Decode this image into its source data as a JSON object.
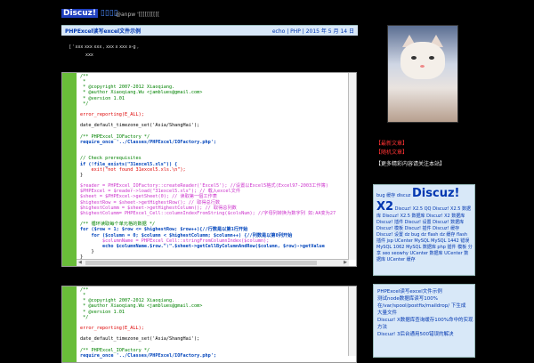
{
  "header": {
    "title": "Discuz!",
    "subtitle": "@anpw '[[[[[[[[[["
  },
  "post": {
    "title": "PHPExcel读写excel文件示例",
    "meta": "echo | PHP | 2015 年 5 月 14 日",
    "intro": "[ ' xxx        xxx              xxx         ,        xxx         x xxx x-g     ,",
    "intro2": "xxx"
  },
  "code_block_1": {
    "lines": [
      "/**",
      " *",
      " * @copyright 2007-2012 Xiaoqiang.",
      " * @author Xiaoqiang.Wu <jamblues@gmail.com>",
      " * @version 1.01",
      " */",
      "",
      "error_reporting(E_ALL);",
      "",
      "date_default_timezone_set('Asia/ShangHai');",
      "",
      "/** PHPExcel_IOFactory */",
      "require_once '../Classes/PHPExcel/IOFactory.php';",
      "",
      "",
      "// Check prerequisites",
      "if (!file_exists(\"31excel5.xls\")) {",
      "    exit(\"not found 31excel5.xls.\\n\");",
      "}",
      "",
      "$reader = PHPExcel_IOFactory::createReader('Excel5'); //设置以Excel5格式(Excel97-2003工作簿)",
      "$PHPExcel = $reader->load(\"31excel5.xls\"); // 载入excel文件",
      "$sheet = $PHPExcel->getSheet(0); // 读取第一個工作表",
      "$highestRow = $sheet->getHighestRow(); // 取得总行数",
      "$highestColumm = $sheet->getHighestColumn(); // 取得总列数",
      "$highestColumm= PHPExcel_Cell::columnIndexFromString($colsNum); //字母列转换为数字列 如:AA变为27",
      "",
      "/** 循环读取每个单元格的数据 */",
      "for ($row = 1; $row <= $highestRow; $row++){//行数是以第1行开始",
      "    for ($column = 0; $column < $highestColumm; $column++) {//列数是以第0列开始",
      "        $columnName = PHPExcel_Cell::stringFromColumnIndex($column);",
      "        echo $columnName.$row.\":\".$sheet->getCellByColumnAndRow($column, $row)->getValue",
      "    }",
      "}",
      "?>"
    ]
  },
  "code_block_2": {
    "lines": [
      "/**",
      " *",
      " * @copyright 2007-2012 Xiaoqiang.",
      " * @author Xiaoqiang.Wu <jamblues@gmail.com>",
      " * @version 1.01",
      " */",
      "",
      "error_reporting(E_ALL);",
      "",
      "date_default_timezone_set('Asia/ShangHai');",
      "",
      "/** PHPExcel_IOFactory */",
      "require_once '../Classes/PHPExcel/IOFactory.php';"
    ]
  },
  "sidebar": {
    "red_link_1": "【最新文章】",
    "red_link_2": "【随机文章】",
    "white_text": "【更多精彩内容请关注本站】",
    "tags_line1": "bug 缓存 discuz",
    "tags_big": "Discuz! X2",
    "tags_rest": "Discuz! X2.5 QQ Discuz! X2.5 数据库 Discuz! X2.5 数据库 Discuz! X2 数据库 Discuz! 插件 Discuz! 设置 Discuz! 数据库 Discuz! 模板 Discuz! 插件 Discuz! 缓存 Discuz! 设置 dz bug dz flash dz 缓存 flash 插件 jsp UCenter MySQL MySQL 1442 错误 MySQL 1062 MySQL 数据库 php 插件 模板 分享 seo seowhy UCenter 数据库 UCenter 数据库 UCenter 缓存",
    "recent_head": "PHPExcel读写excel文件示例",
    "recent": [
      "测试node数据库读写100%",
      "在/var/spool/postfix/maildrop/ 下生成",
      "大量文件",
      "Discuz! X数据库查询缓存100%命中的实现方法",
      "Discuz! 3后台通用500错误的解决"
    ]
  }
}
